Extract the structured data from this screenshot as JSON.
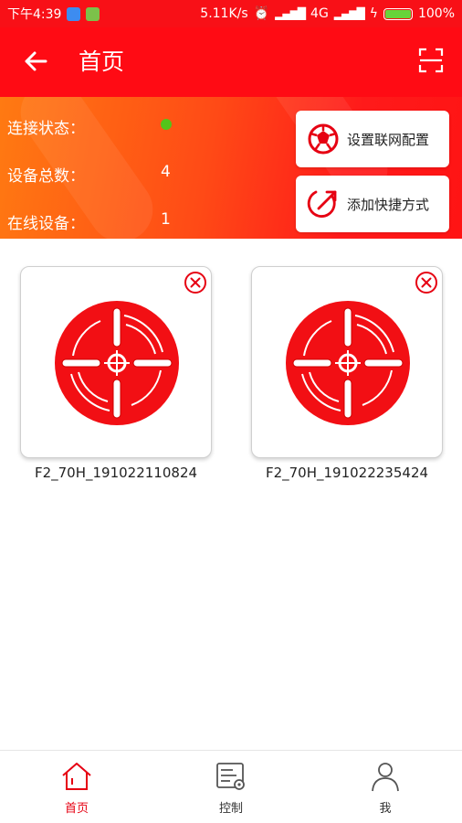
{
  "status_bar": {
    "time": "下午4:39",
    "net_speed": "5.11K/s",
    "network": "4G",
    "battery": "100%"
  },
  "app_bar": {
    "title": "首页"
  },
  "summary": {
    "connection_label": "连接状态：",
    "connection_status_color": "#52c41a",
    "device_total_label": "设备总数：",
    "device_total_value": "4",
    "online_label": "在线设备：",
    "online_value": "1"
  },
  "actions": {
    "network_config_label": "设置联网配置",
    "add_shortcut_label": "添加快捷方式"
  },
  "devices": [
    {
      "name": "F2_70H_191022110824"
    },
    {
      "name": "F2_70H_191022235424"
    }
  ],
  "tabs": [
    {
      "label": "首页",
      "icon": "home-icon",
      "active": true
    },
    {
      "label": "控制",
      "icon": "control-panel-icon",
      "active": false
    },
    {
      "label": "我",
      "icon": "person-icon",
      "active": false
    }
  ],
  "colors": {
    "primary_red": "#ff0b14",
    "accent_red": "#e60012",
    "banner_orange": "#ff7a12"
  }
}
